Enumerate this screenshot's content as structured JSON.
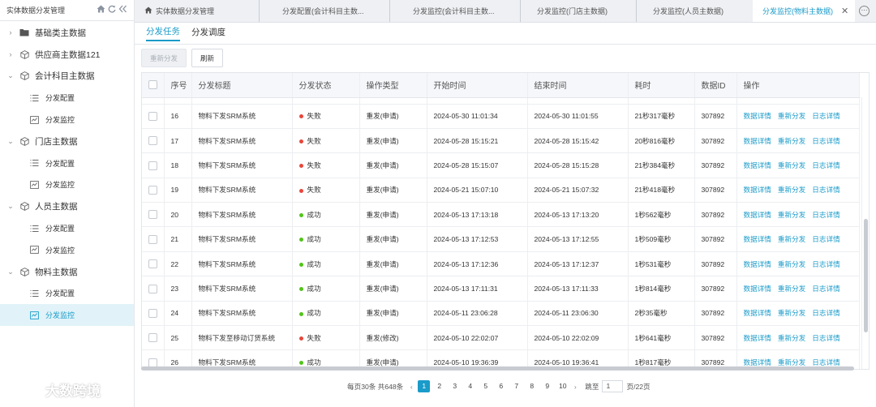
{
  "sidebar": {
    "title": "实体数据分发管理",
    "items": [
      {
        "type": "group",
        "label": "基础类主数据",
        "icon": "folder-icon",
        "expanded": false
      },
      {
        "type": "group",
        "label": "供应商主数据121",
        "icon": "cube-icon",
        "expanded": false
      },
      {
        "type": "group",
        "label": "会计科目主数据",
        "icon": "cube-icon",
        "expanded": true
      },
      {
        "type": "child",
        "label": "分发配置",
        "icon": "list-icon"
      },
      {
        "type": "child",
        "label": "分发监控",
        "icon": "monitor-icon"
      },
      {
        "type": "group",
        "label": "门店主数据",
        "icon": "cube-icon",
        "expanded": true
      },
      {
        "type": "child",
        "label": "分发配置",
        "icon": "list-icon"
      },
      {
        "type": "child",
        "label": "分发监控",
        "icon": "monitor-icon"
      },
      {
        "type": "group",
        "label": "人员主数据",
        "icon": "cube-icon",
        "expanded": true
      },
      {
        "type": "child",
        "label": "分发配置",
        "icon": "list-icon"
      },
      {
        "type": "child",
        "label": "分发监控",
        "icon": "monitor-icon"
      },
      {
        "type": "group",
        "label": "物料主数据",
        "icon": "cube-icon",
        "expanded": true
      },
      {
        "type": "child",
        "label": "分发配置",
        "icon": "list-icon"
      },
      {
        "type": "child",
        "label": "分发监控",
        "icon": "monitor-icon",
        "active": true
      }
    ]
  },
  "tabs": [
    {
      "label": "实体数据分发管理",
      "icon": "home-icon"
    },
    {
      "label": "分发配置(会计科目主数..."
    },
    {
      "label": "分发监控(会计科目主数..."
    },
    {
      "label": "分发监控(门店主数据)"
    },
    {
      "label": "分发监控(人员主数据)"
    },
    {
      "label": "分发监控(物料主数据)",
      "active": true
    }
  ],
  "subtabs": {
    "task": "分发任务",
    "schedule": "分发调度"
  },
  "toolbar": {
    "redistribute": "重新分发",
    "refresh": "刷新"
  },
  "table": {
    "headers": [
      "序号",
      "分发标题",
      "分发状态",
      "操作类型",
      "开始时间",
      "结束时间",
      "耗时",
      "数据ID",
      "操作"
    ],
    "actions": [
      "数据详情",
      "重新分发",
      "日志详情"
    ],
    "status_colors": {
      "失败": "#e8463b",
      "成功": "#52c41a"
    },
    "rows": [
      {
        "no": "16",
        "title": "物料下发SRM系统",
        "status": "失败",
        "op": "重发(申请)",
        "start": "2024-05-30 11:01:34",
        "end": "2024-05-30 11:01:55",
        "cost": "21秒317毫秒",
        "id": "307892"
      },
      {
        "no": "17",
        "title": "物料下发SRM系统",
        "status": "失败",
        "op": "重发(申请)",
        "start": "2024-05-28 15:15:21",
        "end": "2024-05-28 15:15:42",
        "cost": "20秒816毫秒",
        "id": "307892"
      },
      {
        "no": "18",
        "title": "物料下发SRM系统",
        "status": "失败",
        "op": "重发(申请)",
        "start": "2024-05-28 15:15:07",
        "end": "2024-05-28 15:15:28",
        "cost": "21秒384毫秒",
        "id": "307892"
      },
      {
        "no": "19",
        "title": "物料下发SRM系统",
        "status": "失败",
        "op": "重发(申请)",
        "start": "2024-05-21 15:07:10",
        "end": "2024-05-21 15:07:32",
        "cost": "21秒418毫秒",
        "id": "307892"
      },
      {
        "no": "20",
        "title": "物料下发SRM系统",
        "status": "成功",
        "op": "重发(申请)",
        "start": "2024-05-13 17:13:18",
        "end": "2024-05-13 17:13:20",
        "cost": "1秒562毫秒",
        "id": "307892"
      },
      {
        "no": "21",
        "title": "物料下发SRM系统",
        "status": "成功",
        "op": "重发(申请)",
        "start": "2024-05-13 17:12:53",
        "end": "2024-05-13 17:12:55",
        "cost": "1秒509毫秒",
        "id": "307892"
      },
      {
        "no": "22",
        "title": "物料下发SRM系统",
        "status": "成功",
        "op": "重发(申请)",
        "start": "2024-05-13 17:12:36",
        "end": "2024-05-13 17:12:37",
        "cost": "1秒531毫秒",
        "id": "307892"
      },
      {
        "no": "23",
        "title": "物料下发SRM系统",
        "status": "成功",
        "op": "重发(申请)",
        "start": "2024-05-13 17:11:31",
        "end": "2024-05-13 17:11:33",
        "cost": "1秒814毫秒",
        "id": "307892"
      },
      {
        "no": "24",
        "title": "物料下发SRM系统",
        "status": "成功",
        "op": "重发(申请)",
        "start": "2024-05-11 23:06:28",
        "end": "2024-05-11 23:06:30",
        "cost": "2秒35毫秒",
        "id": "307892"
      },
      {
        "no": "25",
        "title": "物料下发至移动订货系统",
        "status": "失败",
        "op": "重发(修改)",
        "start": "2024-05-10 22:02:07",
        "end": "2024-05-10 22:02:09",
        "cost": "1秒641毫秒",
        "id": "307892"
      },
      {
        "no": "26",
        "title": "物料下发SRM系统",
        "status": "成功",
        "op": "重发(申请)",
        "start": "2024-05-10 19:36:39",
        "end": "2024-05-10 19:36:41",
        "cost": "1秒817毫秒",
        "id": "307892"
      }
    ]
  },
  "pager": {
    "info": "每页30条 共648条",
    "pages": [
      "1",
      "2",
      "3",
      "4",
      "5",
      "6",
      "7",
      "8",
      "9",
      "10"
    ],
    "current": "1",
    "goto_label": "跳至",
    "goto_value": "1",
    "total_pages": "页/22页"
  },
  "watermark": {
    "text": "大数跨境"
  }
}
